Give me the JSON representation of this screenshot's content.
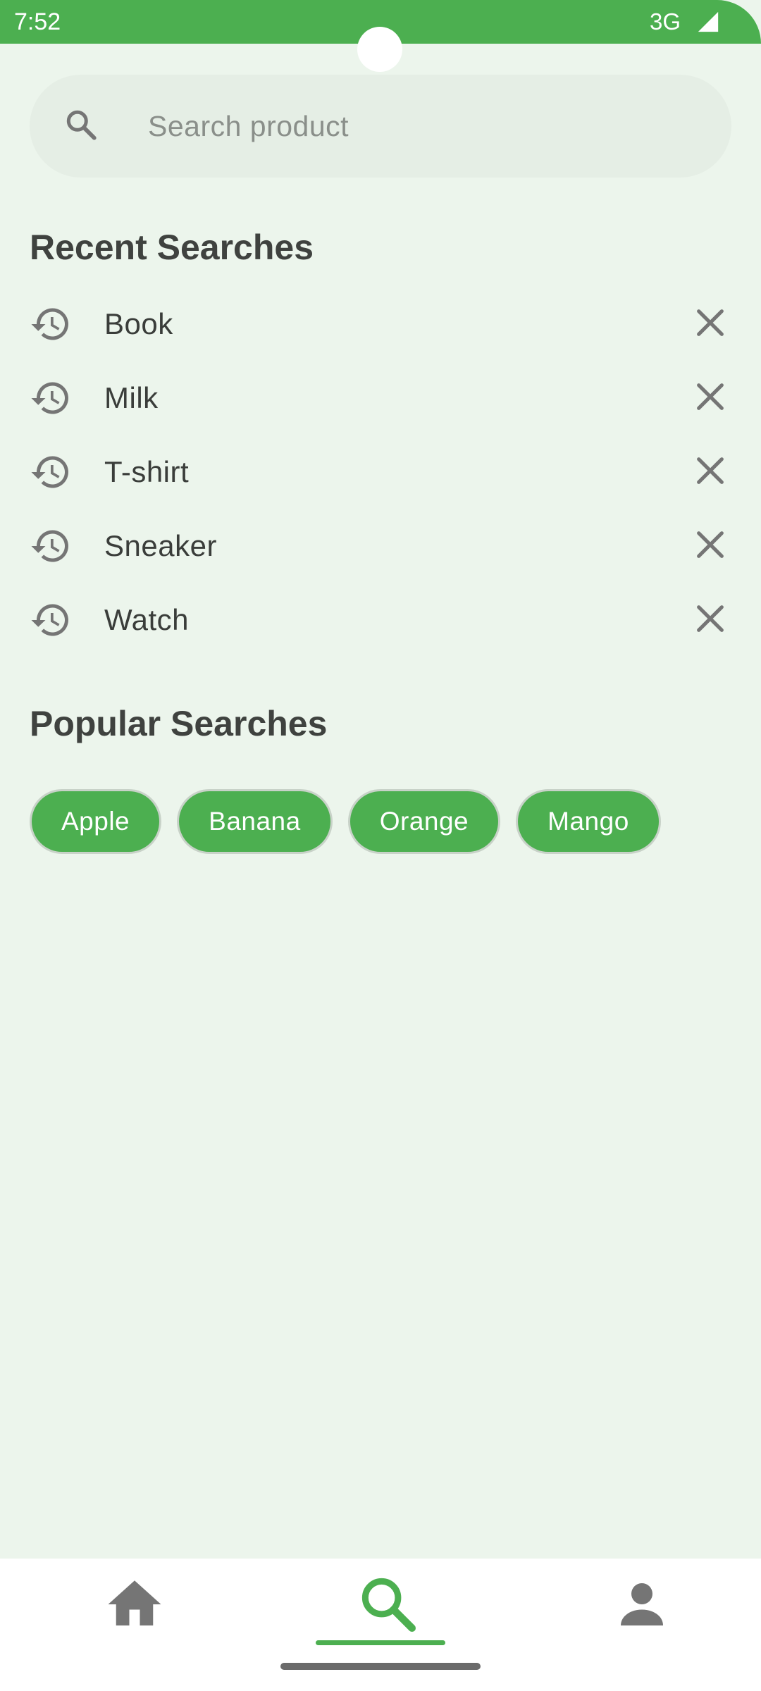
{
  "status_bar": {
    "time": "7:52",
    "network": "3G",
    "icons": [
      "signal-icon"
    ]
  },
  "search": {
    "placeholder": "Search product",
    "value": "",
    "icon": "search-icon"
  },
  "recent": {
    "title": "Recent Searches",
    "items": [
      {
        "label": "Book"
      },
      {
        "label": "Milk"
      },
      {
        "label": "T-shirt"
      },
      {
        "label": "Sneaker"
      },
      {
        "label": "Watch"
      }
    ],
    "item_icon": "history-icon",
    "remove_icon": "close-icon"
  },
  "popular": {
    "title": "Popular Searches",
    "chips": [
      "Apple",
      "Banana",
      "Orange",
      "Mango"
    ]
  },
  "bottom_nav": {
    "items": [
      {
        "icon": "home-icon",
        "active": false
      },
      {
        "icon": "search-icon",
        "active": true
      },
      {
        "icon": "person-icon",
        "active": false
      }
    ]
  },
  "colors": {
    "accent": "#4CAF50",
    "background": "#ECF5EC",
    "search_bar": "#E5EEE5",
    "text_dark": "#3f423f",
    "icon_gray": "#757575"
  }
}
